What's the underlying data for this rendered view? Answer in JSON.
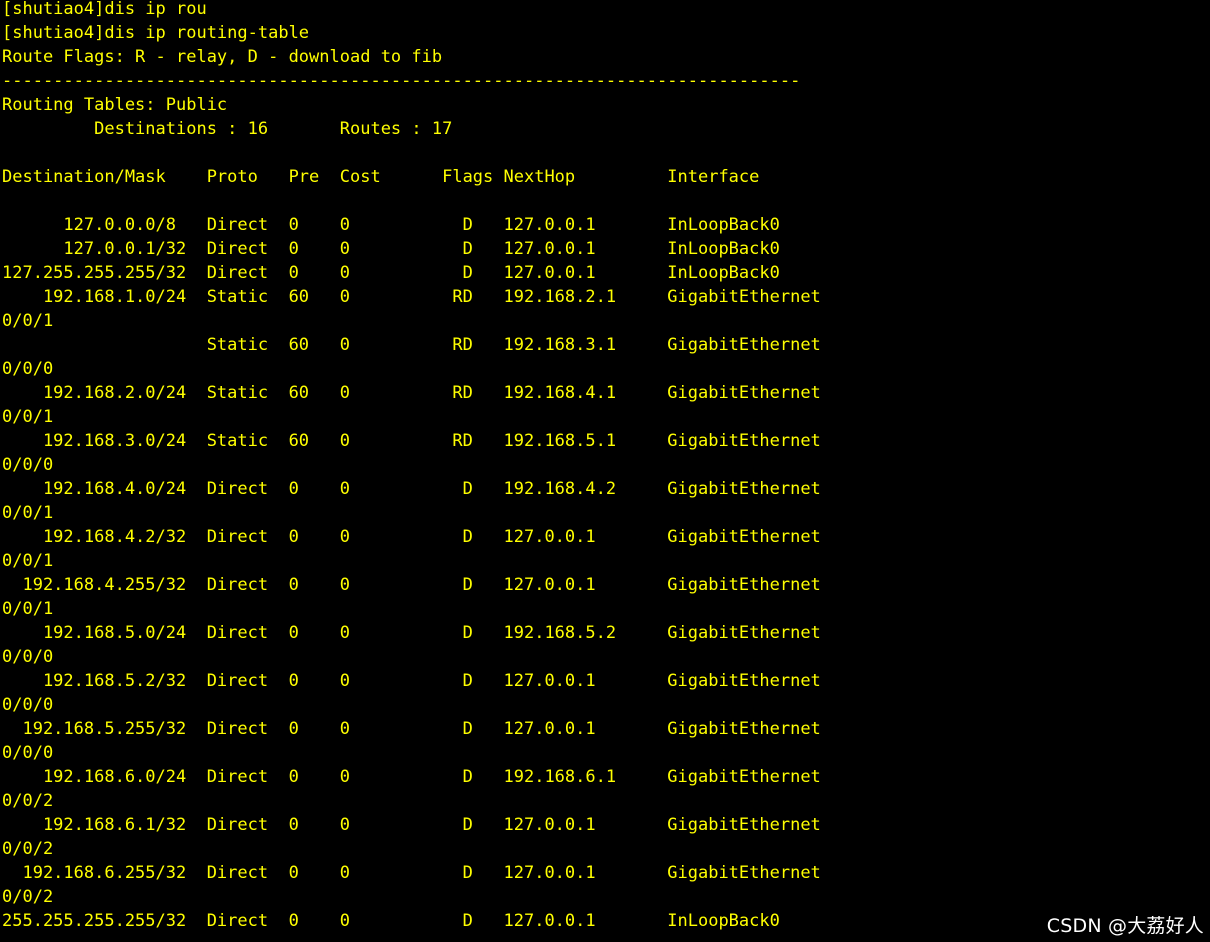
{
  "terminal": {
    "text_color": "#ffff00",
    "background": "#000000",
    "lines": [
      "[shutiao4]dis ip rou",
      "[shutiao4]dis ip routing-table",
      "Route Flags: R - relay, D - download to fib",
      "------------------------------------------------------------------------------",
      "Routing Tables: Public",
      "         Destinations : 16       Routes : 17",
      "",
      "Destination/Mask    Proto   Pre  Cost      Flags NextHop         Interface",
      "",
      "      127.0.0.0/8   Direct  0    0           D   127.0.0.1       InLoopBack0",
      "      127.0.0.1/32  Direct  0    0           D   127.0.0.1       InLoopBack0",
      "127.255.255.255/32  Direct  0    0           D   127.0.0.1       InLoopBack0",
      "    192.168.1.0/24  Static  60   0          RD   192.168.2.1     GigabitEthernet",
      "0/0/1",
      "                    Static  60   0          RD   192.168.3.1     GigabitEthernet",
      "0/0/0",
      "    192.168.2.0/24  Static  60   0          RD   192.168.4.1     GigabitEthernet",
      "0/0/1",
      "    192.168.3.0/24  Static  60   0          RD   192.168.5.1     GigabitEthernet",
      "0/0/0",
      "    192.168.4.0/24  Direct  0    0           D   192.168.4.2     GigabitEthernet",
      "0/0/1",
      "    192.168.4.2/32  Direct  0    0           D   127.0.0.1       GigabitEthernet",
      "0/0/1",
      "  192.168.4.255/32  Direct  0    0           D   127.0.0.1       GigabitEthernet",
      "0/0/1",
      "    192.168.5.0/24  Direct  0    0           D   192.168.5.2     GigabitEthernet",
      "0/0/0",
      "    192.168.5.2/32  Direct  0    0           D   127.0.0.1       GigabitEthernet",
      "0/0/0",
      "  192.168.5.255/32  Direct  0    0           D   127.0.0.1       GigabitEthernet",
      "0/0/0",
      "    192.168.6.0/24  Direct  0    0           D   192.168.6.1     GigabitEthernet",
      "0/0/2",
      "    192.168.6.1/32  Direct  0    0           D   127.0.0.1       GigabitEthernet",
      "0/0/2",
      "  192.168.6.255/32  Direct  0    0           D   127.0.0.1       GigabitEthernet",
      "0/0/2",
      "255.255.255.255/32  Direct  0    0           D   127.0.0.1       InLoopBack0"
    ]
  },
  "watermark": {
    "text": "CSDN @大荔好人"
  }
}
